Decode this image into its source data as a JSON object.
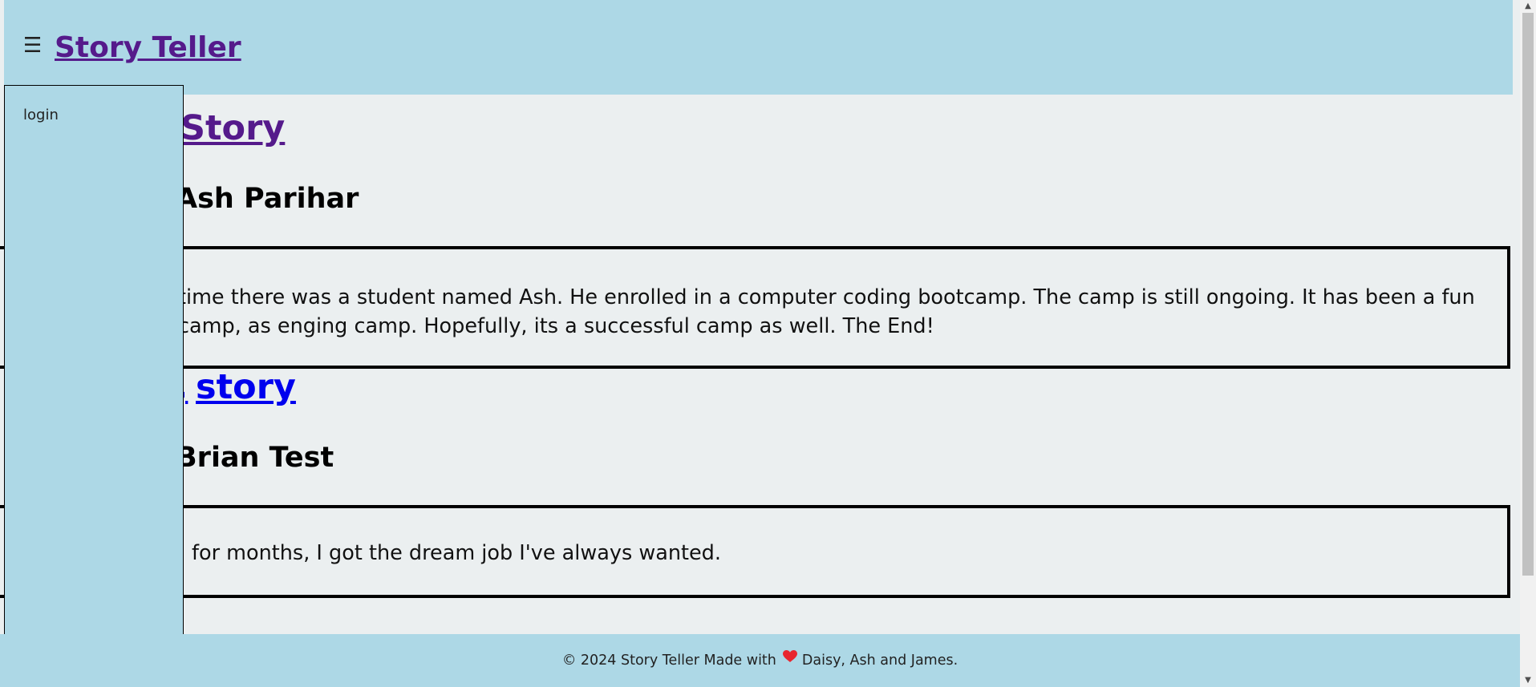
{
  "header": {
    "menu_glyph": "☰",
    "site_title": "Story Teller"
  },
  "sidebar": {
    "login_label": "login"
  },
  "stories": [
    {
      "title": "Story",
      "author": "Ash Parihar",
      "text": "time there was a student named Ash. He enrolled in a computer coding bootcamp. The camp is still ongoing. It has been a fun camp, as enging camp. Hopefully, its a successful camp as well. The End!"
    },
    {
      "title": "story",
      "author": "Brian Test",
      "text": "for months, I got the dream job I've always wanted."
    }
  ],
  "footer": {
    "copyright_text": "© 2024 Story Teller Made with",
    "heart_icon": "heart-icon",
    "credits_text": "Daisy, Ash and James.",
    "heart_color": "#e8262f"
  },
  "colors": {
    "header_bg": "#add8e6",
    "page_bg": "#ebeff0",
    "visited_link": "#551a8b",
    "unvisited_link": "#0000ee"
  }
}
